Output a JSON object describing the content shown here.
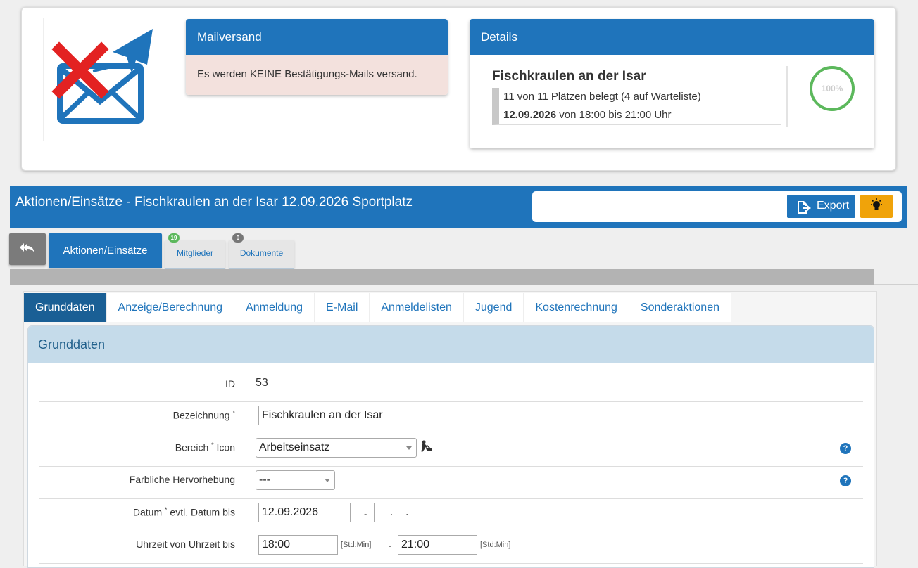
{
  "mail_panel": {
    "title": "Mailversand",
    "message": "Es werden KEINE Bestätigungs-Mails versand."
  },
  "details_panel": {
    "title": "Details",
    "event_name": "Fischkraulen an der Isar",
    "occupancy": "11 von 11 Plätzen belegt (4 auf Warteliste)",
    "date": "12.09.2026",
    "time_text": "von 18:00 bis 21:00 Uhr",
    "gauge_percent": "100%",
    "gauge_value": 100
  },
  "header": {
    "title": "Aktionen/Einsätze - Fischkraulen an der Isar 12.09.2026 Sportplatz",
    "export_label": "Export"
  },
  "tabs": {
    "main": "Aktionen/Einsätze",
    "members": {
      "label": "Mitglieder",
      "badge": "19"
    },
    "documents": {
      "label": "Dokumente",
      "badge": "0"
    }
  },
  "nav_tabs": [
    "Grunddaten",
    "Anzeige/Berechnung",
    "Anmeldung",
    "E-Mail",
    "Anmeldelisten",
    "Jugend",
    "Kostenrechnung",
    "Sonderaktionen"
  ],
  "form": {
    "section_title": "Grunddaten",
    "id_label": "ID",
    "id_value": "53",
    "name_label": "Bezeichnung",
    "name_value": "Fischkraulen an der Isar",
    "area_label": "Bereich",
    "icon_label": "Icon",
    "area_value": "Arbeitseinsatz",
    "color_label": "Farbliche Hervorhebung",
    "color_value": "---",
    "date_label": "Datum",
    "date_to_label": "evtl. Datum bis",
    "date_value": "12.09.2026",
    "date_to_value": "__.__.____",
    "time_label": "Uhrzeit von Uhrzeit bis",
    "time_from_value": "18:00",
    "time_to_value": "21:00",
    "time_hint": "[Std:Min]",
    "required_mark": "*",
    "range_separator": "-",
    "help_glyph": "?"
  },
  "colors": {
    "primary": "#1f74bb",
    "mail_bg": "#f3e1dd",
    "gauge": "#5cb85c",
    "bulb": "#f0a30a",
    "badge_green": "#5cb85c",
    "badge_gray": "#777777"
  }
}
